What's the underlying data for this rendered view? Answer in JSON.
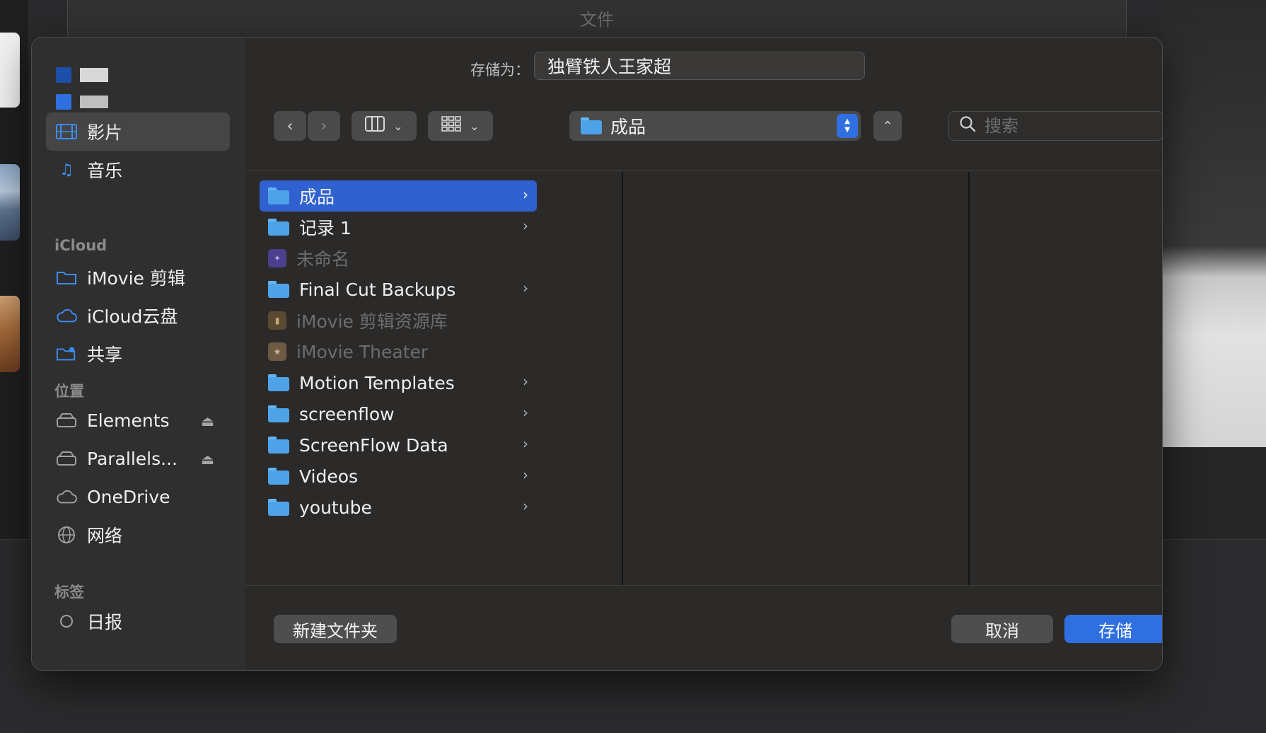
{
  "background": {
    "window_title": "文件"
  },
  "dialog": {
    "save_as_label": "存储为：",
    "save_as_value": "独臂铁人王家超",
    "location": "成品",
    "search_placeholder": "搜索"
  },
  "sidebar": {
    "favorites": [
      {
        "label": "影片",
        "icon": "film-icon",
        "selected": true
      },
      {
        "label": "音乐",
        "icon": "music-note-icon",
        "selected": false
      }
    ],
    "icloud_heading": "iCloud",
    "icloud": [
      {
        "label": "iMovie 剪辑",
        "icon": "folder-outline-icon"
      },
      {
        "label": "iCloud云盘",
        "icon": "cloud-icon"
      },
      {
        "label": "共享",
        "icon": "shared-folder-icon"
      }
    ],
    "locations_heading": "位置",
    "locations": [
      {
        "label": "Elements",
        "icon": "drive-icon",
        "eject": true
      },
      {
        "label": "Parallels...",
        "icon": "drive-icon",
        "eject": true
      },
      {
        "label": "OneDrive",
        "icon": "cloud-icon",
        "eject": false
      },
      {
        "label": "网络",
        "icon": "globe-icon",
        "eject": false
      }
    ],
    "tags_heading": "标签",
    "tags": [
      {
        "label": "日报",
        "icon": "tag-circle-icon"
      }
    ]
  },
  "files": [
    {
      "name": "成品",
      "type": "folder",
      "selected": true,
      "dim": false,
      "chevron": true
    },
    {
      "name": "记录 1",
      "type": "folder",
      "selected": false,
      "dim": false,
      "chevron": true
    },
    {
      "name": "未命名",
      "type": "app",
      "selected": false,
      "dim": true,
      "chevron": false
    },
    {
      "name": "Final Cut Backups",
      "type": "folder",
      "selected": false,
      "dim": false,
      "chevron": true
    },
    {
      "name": "iMovie 剪辑资源库",
      "type": "library",
      "selected": false,
      "dim": true,
      "chevron": false
    },
    {
      "name": "iMovie Theater",
      "type": "theater",
      "selected": false,
      "dim": true,
      "chevron": false
    },
    {
      "name": "Motion Templates",
      "type": "folder",
      "selected": false,
      "dim": false,
      "chevron": true
    },
    {
      "name": "screenflow",
      "type": "folder",
      "selected": false,
      "dim": false,
      "chevron": true
    },
    {
      "name": "ScreenFlow Data",
      "type": "folder",
      "selected": false,
      "dim": false,
      "chevron": true
    },
    {
      "name": "Videos",
      "type": "folder",
      "selected": false,
      "dim": false,
      "chevron": true
    },
    {
      "name": "youtube",
      "type": "folder",
      "selected": false,
      "dim": false,
      "chevron": true
    }
  ],
  "footer": {
    "new_folder": "新建文件夹",
    "cancel": "取消",
    "save": "存储"
  },
  "colors": {
    "accent": "#2f6fe0",
    "selection": "#2f62d0",
    "folder": "#4ea3e8"
  }
}
